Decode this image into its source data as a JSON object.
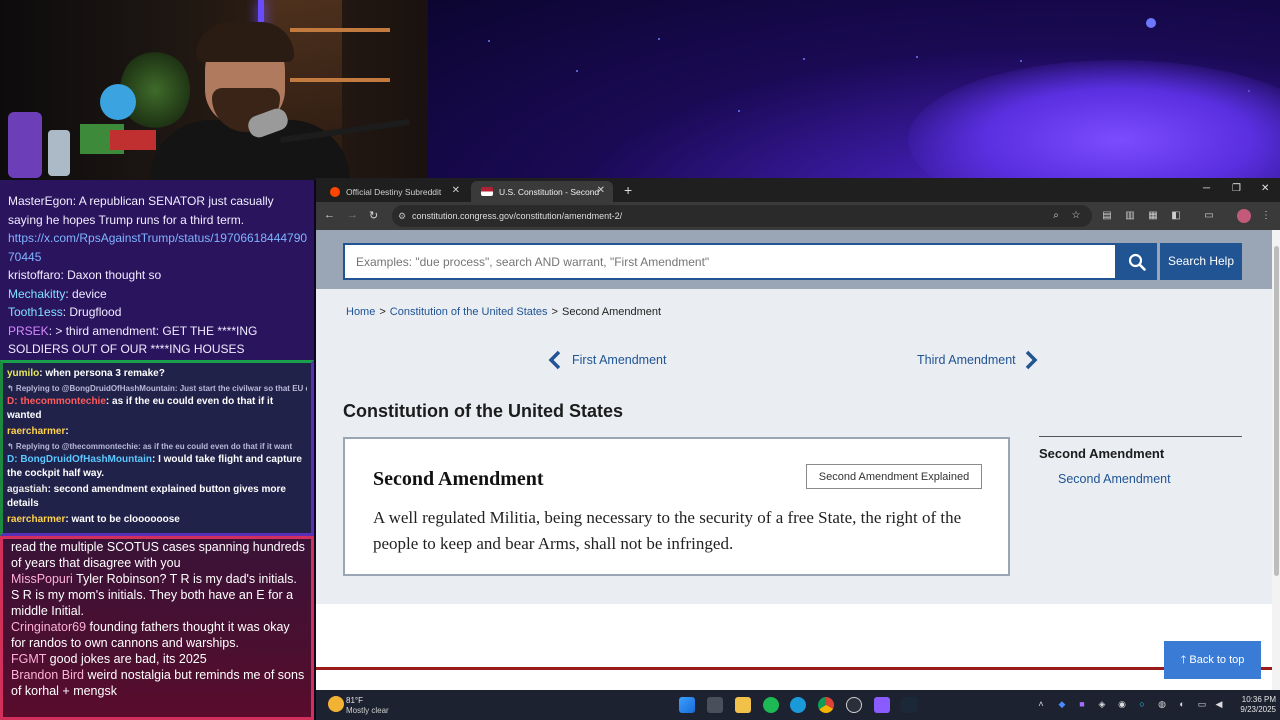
{
  "chat1": {
    "messages": [
      {
        "user": "MasterEgon",
        "text": ": A republican SENATOR just casually saying he hopes Trump runs for a third term.",
        "color": "#ffffff"
      },
      {
        "user": "",
        "text": "https://x.com/RpsAgainstTrump/status/1970661844479070445",
        "color": "#7fb4ff"
      },
      {
        "user": "kristoffaro",
        "text": ": Daxon thought so",
        "color": "#ffffff"
      },
      {
        "user": "Mechakitty",
        "text": ": device",
        "color": "#7fe0ff"
      },
      {
        "user": "Tooth1ess",
        "text": ": Drugflood",
        "color": "#7fe0ff"
      },
      {
        "user": "PRSEK",
        "text": ": > third amendment: GET THE ****ING SOLDIERS OUT OF OUR ****ING HOUSES",
        "color": "#d58bff"
      }
    ]
  },
  "chat2": {
    "items": [
      {
        "kind": "msg",
        "user": "yumilo",
        "text": ": when persona 3 remake?",
        "color": "#e8e85a"
      },
      {
        "kind": "reply",
        "text": "↰ Replying to @BongDruidOfHashMountain: Just start the civilwar so that EU c..."
      },
      {
        "kind": "msg",
        "user": "D: thecommontechie",
        "text": ": as if the eu could even do that if it wanted",
        "color": "#ff5a5a"
      },
      {
        "kind": "msg",
        "user": "raercharmer",
        "text": ":",
        "color": "#ffd24a"
      },
      {
        "kind": "reply",
        "text": "↰ Replying to @thecommontechie: as if the eu could even do that if it want"
      },
      {
        "kind": "msg",
        "user": "D: BongDruidOfHashMountain",
        "text": ": I would take flight and capture the cockpit half way.",
        "color": "#5ac8ff"
      },
      {
        "kind": "msg",
        "user": "agastiah",
        "text": ": second amendment explained button gives more details",
        "color": "#e8e8e8"
      },
      {
        "kind": "msg",
        "user": "raercharmer",
        "text": ": want to be cloooooose",
        "color": "#ffd24a"
      }
    ]
  },
  "chat3": {
    "messages": [
      {
        "user": "",
        "text": "read the multiple SCOTUS cases spanning hundreds of years that disagree with you",
        "color": "#ffffff"
      },
      {
        "user": "MissPopuri",
        "text": " Tyler Robinson? T R is my dad's initials. S R is my mom's initials. They both have an E for a middle Initial.",
        "color": "#ff9fc9"
      },
      {
        "user": "Cringinator69",
        "text": " founding fathers thought it was okay for randos to own cannons and warships.",
        "color": "#ff9fc9"
      },
      {
        "user": "FGMT",
        "text": " good jokes are bad, its 2025",
        "color": "#ff9fc9"
      },
      {
        "user": "Brandon Bird",
        "text": " weird nostalgia but reminds me of sons of korhal + mengsk",
        "color": "#ff9fc9"
      }
    ]
  },
  "browser": {
    "tabs": [
      {
        "label": "Official Destiny Subreddit",
        "icon": "reddit-icon"
      },
      {
        "label": "U.S. Constitution - Second Amer",
        "icon": "us-flag-icon"
      }
    ],
    "new_tab": "+",
    "url": "constitution.congress.gov/constitution/amendment-2/",
    "win_min": "─",
    "win_max": "❐",
    "win_close": "✕"
  },
  "page": {
    "search_placeholder": "Examples: \"due process\", search AND warrant, \"First Amendment\"",
    "search_help": "Search Help",
    "breadcrumb": {
      "home": "Home",
      "sep1": ">",
      "constitution": "Constitution of the United States",
      "sep2": ">",
      "current": "Second Amendment"
    },
    "prev_label": "First Amendment",
    "next_label": "Third Amendment",
    "section_title": "Constitution of the United States",
    "card": {
      "title": "Second Amendment",
      "explain_button": "Second Amendment Explained",
      "text": "A well regulated Militia, being necessary to the security of a free State, the right of the people to keep and bear Arms, shall not be infringed."
    },
    "sidebar": {
      "title": "Second Amendment",
      "link": "Second Amendment"
    },
    "back_to_top": "Back to top"
  },
  "taskbar": {
    "weather_temp": "81°F",
    "weather_cond": "Mostly clear",
    "time": "10:36 PM",
    "date": "9/23/2025"
  },
  "colors": {
    "accent": "#205493",
    "back_to_top": "#3a7bd5"
  }
}
